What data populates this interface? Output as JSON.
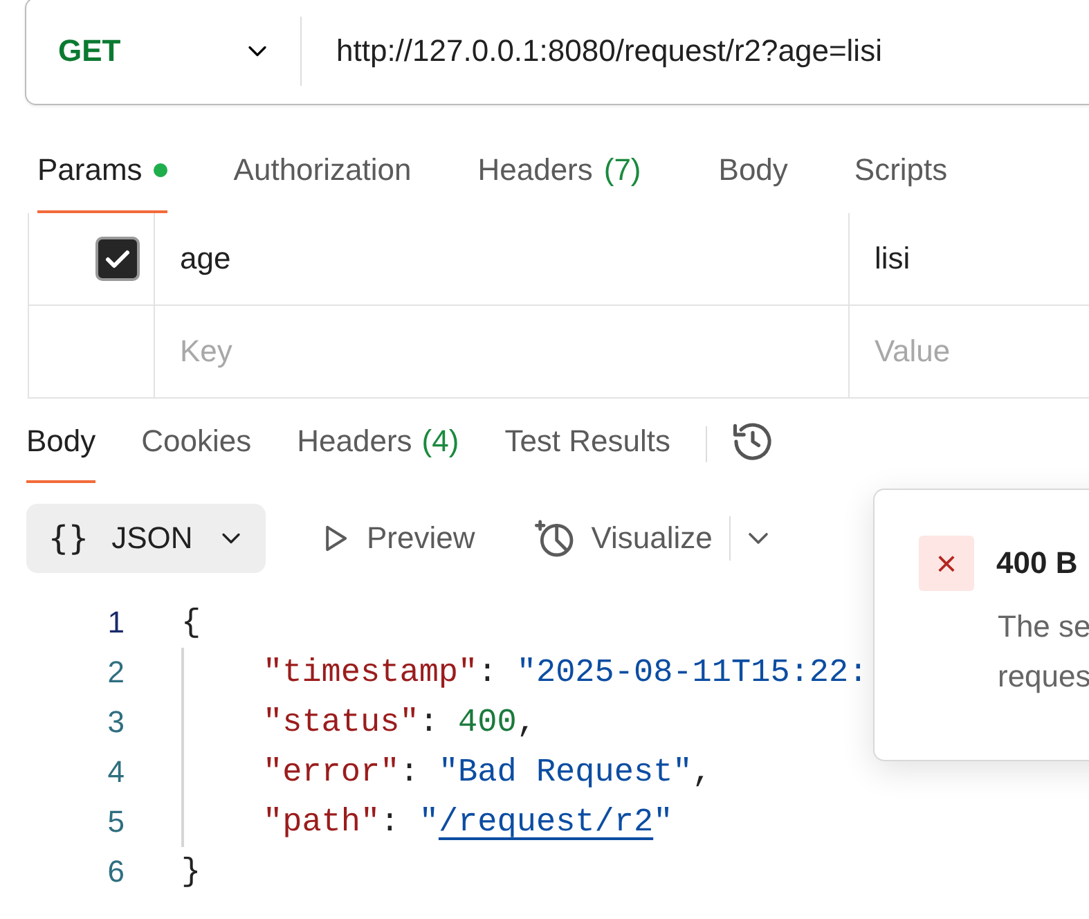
{
  "request": {
    "method": "GET",
    "url": "http://127.0.0.1:8080/request/r2?age=lisi"
  },
  "request_tabs": [
    {
      "label": "Params",
      "selected": true,
      "dot": true
    },
    {
      "label": "Authorization",
      "selected": false,
      "dot": false
    },
    {
      "label": "Headers",
      "count": "(7)",
      "selected": false,
      "dot": false
    },
    {
      "label": "Body",
      "selected": false,
      "dot": false
    },
    {
      "label": "Scripts",
      "selected": false,
      "dot": false
    }
  ],
  "params": {
    "rows": [
      {
        "checked": true,
        "key": "age",
        "value": "lisi"
      }
    ],
    "new_row": {
      "key_placeholder": "Key",
      "value_placeholder": "Value"
    }
  },
  "response_tabs": [
    {
      "label": "Body",
      "selected": true
    },
    {
      "label": "Cookies",
      "selected": false
    },
    {
      "label": "Headers",
      "count": "(4)",
      "selected": false
    },
    {
      "label": "Test Results",
      "selected": false
    }
  ],
  "toolbar": {
    "format_icon": "{}",
    "format": "JSON",
    "preview": "Preview",
    "visualize": "Visualize"
  },
  "code": {
    "lines": [
      {
        "number": "1",
        "current": true,
        "tokens": [
          {
            "kind": "punct",
            "text": "{"
          }
        ],
        "children": [
          {
            "number": "2",
            "current": false,
            "tokens": [
              {
                "kind": "key",
                "text": "\"timestamp\""
              },
              {
                "kind": "punct",
                "text": ": "
              },
              {
                "kind": "string",
                "text": "\"2025-08-11T15:22:"
              }
            ]
          },
          {
            "number": "3",
            "current": false,
            "tokens": [
              {
                "kind": "key",
                "text": "\"status\""
              },
              {
                "kind": "punct",
                "text": ": "
              },
              {
                "kind": "number",
                "text": "400"
              },
              {
                "kind": "punct",
                "text": ","
              }
            ]
          },
          {
            "number": "4",
            "current": false,
            "tokens": [
              {
                "kind": "key",
                "text": "\"error\""
              },
              {
                "kind": "punct",
                "text": ": "
              },
              {
                "kind": "string",
                "text": "\"Bad Request\""
              },
              {
                "kind": "punct",
                "text": ","
              }
            ]
          },
          {
            "number": "5",
            "current": false,
            "tokens": [
              {
                "kind": "key",
                "text": "\"path\""
              },
              {
                "kind": "punct",
                "text": ": "
              },
              {
                "kind": "string",
                "text": "\""
              },
              {
                "kind": "link",
                "text": "/request/r2"
              },
              {
                "kind": "string",
                "text": "\""
              }
            ]
          }
        ]
      },
      {
        "number": "6",
        "current": false,
        "tokens": [
          {
            "kind": "punct",
            "text": "}"
          }
        ]
      }
    ]
  },
  "toast": {
    "icon": "×",
    "title": "400 B",
    "message_lines": [
      "The se",
      "reques"
    ]
  }
}
